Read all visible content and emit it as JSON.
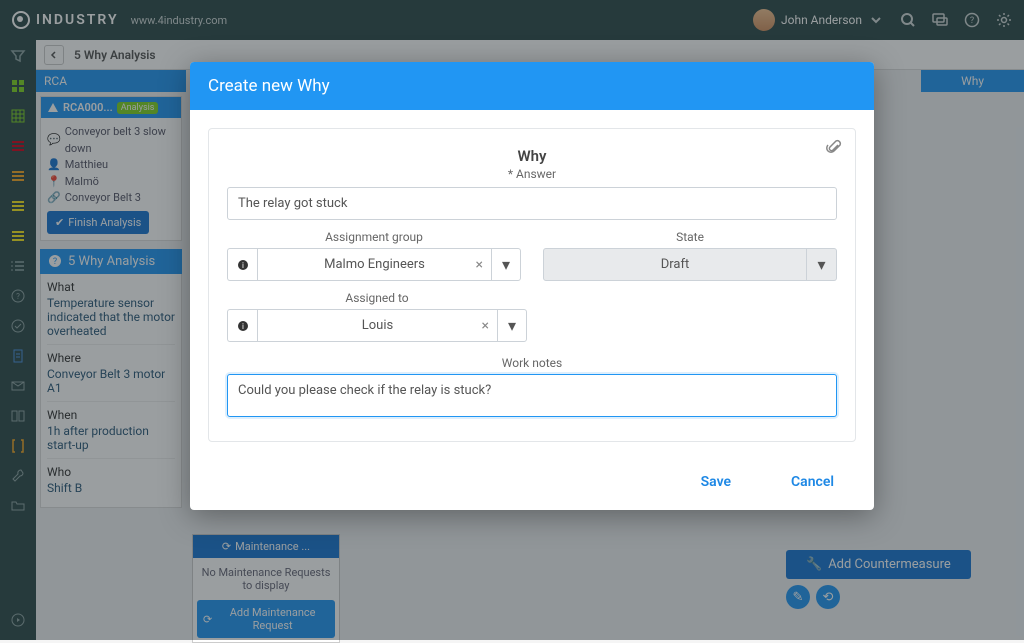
{
  "header": {
    "brand": "INDUSTRY",
    "url": "www.4industry.com",
    "user": "John Anderson"
  },
  "breadcrumb": "5 Why Analysis",
  "rca": {
    "tab": "RCA",
    "id": "RCA000...",
    "status": "Analysis",
    "desc": "Conveyor belt 3 slow down",
    "person": "Matthieu",
    "location": "Malmö",
    "asset": "Conveyor Belt 3",
    "finish_btn": "Finish Analysis"
  },
  "analysis": {
    "title": "5 Why Analysis",
    "what_q": "What",
    "what_a": "Temperature sensor indicated that the motor overheated",
    "where_q": "Where",
    "where_a": "Conveyor Belt 3 motor A1",
    "when_q": "When",
    "when_a": "1h after production start-up",
    "who_q": "Who",
    "who_a": "Shift B"
  },
  "maintenance": {
    "title": "Maintenance ...",
    "empty": "No Maintenance Requests to display",
    "add": "Add Maintenance Request"
  },
  "right": {
    "why_tab": "Why",
    "counter": "Add Countermeasure"
  },
  "modal": {
    "title": "Create new Why",
    "section": "Why",
    "answer_label": "* Answer",
    "answer_value": "The relay got stuck",
    "assign_group_label": "Assignment group",
    "assign_group_value": "Malmo Engineers",
    "state_label": "State",
    "state_value": "Draft",
    "assigned_to_label": "Assigned to",
    "assigned_to_value": "Louis",
    "work_notes_label": "Work notes",
    "work_notes_value": "Could you please check if the relay is stuck?",
    "save": "Save",
    "cancel": "Cancel"
  }
}
